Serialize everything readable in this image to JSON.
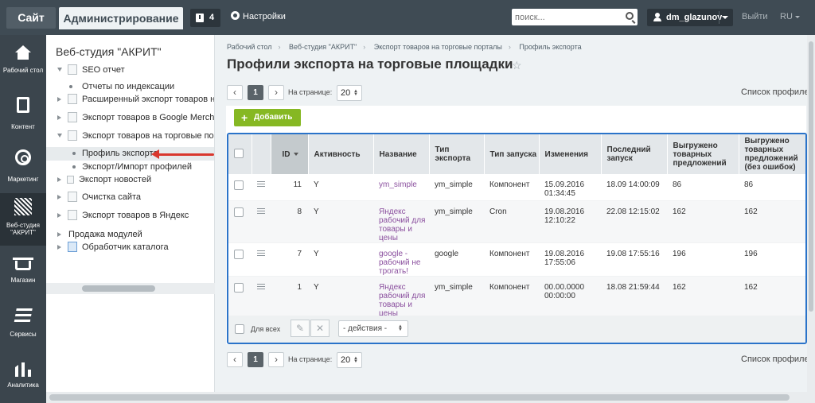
{
  "topbar": {
    "site_tab": "Сайт",
    "admin_tab": "Администрирование",
    "notifications_count": "4",
    "settings_label": "Настройки",
    "search_placeholder": "поиск...",
    "user_name": "dm_glazunov",
    "logout_label": "Выйти",
    "lang_label": "RU"
  },
  "rail": {
    "items": [
      {
        "label": "Рабочий стол",
        "icon": "home-icon"
      },
      {
        "label": "Контент",
        "icon": "document-icon"
      },
      {
        "label": "Маркетинг",
        "icon": "target-icon"
      },
      {
        "label": "Веб-студия \"АКРИТ\"",
        "icon": "akrit-logo-icon"
      },
      {
        "label": "Магазин",
        "icon": "basket-icon"
      },
      {
        "label": "Сервисы",
        "icon": "layers-icon"
      },
      {
        "label": "Аналитика",
        "icon": "bar-chart-icon"
      }
    ]
  },
  "tree": {
    "title": "Веб-студия \"АКРИТ\"",
    "items": [
      "SEO отчет",
      "Отчеты по индексации",
      "Расширенный экспорт товаров на то",
      "Экспорт товаров в Google Merchants",
      "Экспорт товаров на торговые портал",
      "Профиль экспорта",
      "Экспорт/Импорт профилей",
      "Экспорт новостей",
      "Очистка сайта",
      "Экспорт товаров в Яндекс",
      "Продажа модулей",
      "Обработчик каталога"
    ]
  },
  "breadcrumbs": [
    "Рабочий стол",
    "Веб-студия \"АКРИТ\"",
    "Экспорт товаров на торговые порталы",
    "Профиль экспорта"
  ],
  "page_title": "Профили экспорта на торговые площадки",
  "pager": {
    "page": "1",
    "per_page_label": "На странице:",
    "per_page_value": "20",
    "list_label": "Список профилей"
  },
  "add_button": "Добавить",
  "table": {
    "headers": {
      "id": "ID",
      "active": "Активность",
      "name": "Название",
      "export_type": "Тип экспорта",
      "launch_type": "Тип запуска",
      "changed": "Изменения",
      "last_run": "Последний запуск",
      "exported": "Выгружено товарных предложений",
      "exported_ok": "Выгружено товарных предложений (без ошибок)"
    },
    "rows": [
      {
        "id": "11",
        "active": "Y",
        "name": "ym_simple",
        "export_type": "ym_simple",
        "launch_type": "Компонент",
        "changed": "15.09.2016 01:34:45",
        "last_run": "18.09 14:00:09",
        "exported": "86",
        "exported_ok": "86"
      },
      {
        "id": "8",
        "active": "Y",
        "name": "Яндекс рабочий для товары и цены",
        "export_type": "ym_simple",
        "launch_type": "Cron",
        "changed": "19.08.2016 12:10:22",
        "last_run": "22.08 12:15:02",
        "exported": "162",
        "exported_ok": "162"
      },
      {
        "id": "7",
        "active": "Y",
        "name": "google - рабочий не трогать!",
        "export_type": "google",
        "launch_type": "Компонент",
        "changed": "19.08.2016 17:55:06",
        "last_run": "19.08 17:55:16",
        "exported": "196",
        "exported_ok": "196"
      },
      {
        "id": "1",
        "active": "Y",
        "name": "Яндекс рабочий для товары и цены",
        "export_type": "ym_simple",
        "launch_type": "Компонент",
        "changed": "00.00.0000 00:00:00",
        "last_run": "18.08 21:59:44",
        "exported": "162",
        "exported_ok": "162"
      }
    ],
    "for_all_label": "Для всех",
    "actions_label": "- действия -"
  }
}
